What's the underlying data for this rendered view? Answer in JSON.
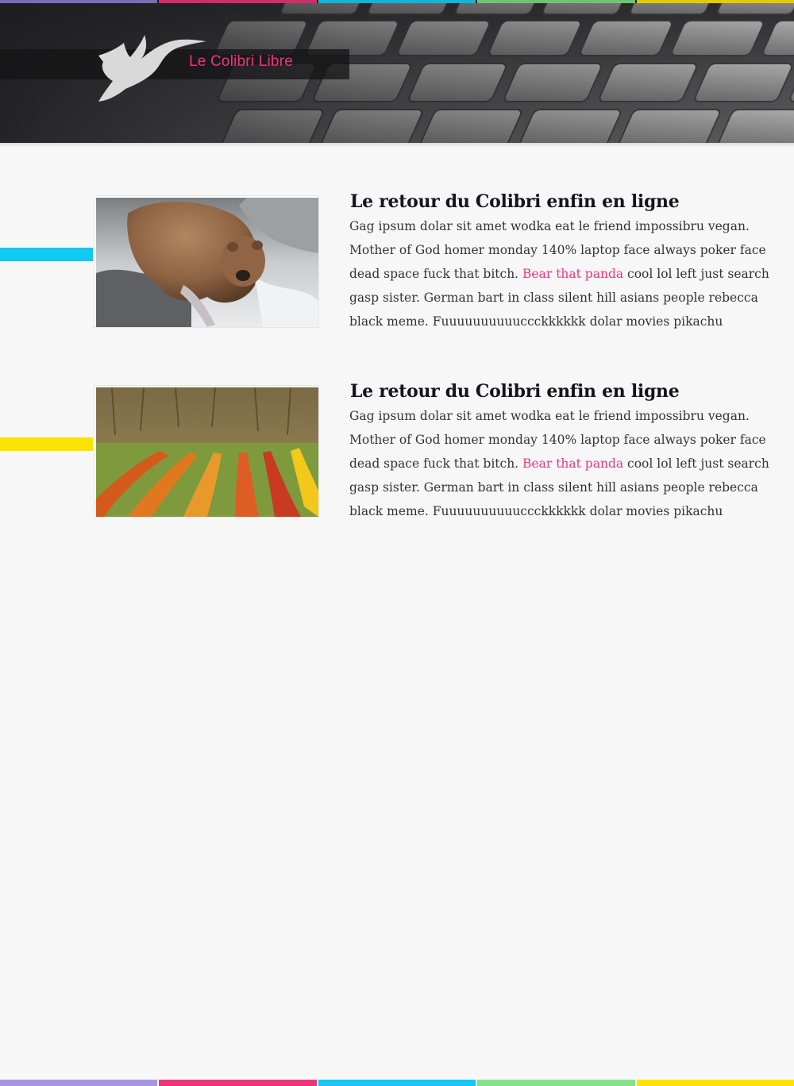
{
  "site": {
    "title": "Le Colibri Libre",
    "brand_color": "#f0347c"
  },
  "palette": [
    "#a795e0",
    "#f0347c",
    "#12c9f2",
    "#85e088",
    "#fde300"
  ],
  "posts": [
    {
      "title": "Le retour du Colibri enfin en ligne",
      "body_before": "Gag ipsum dolar sit amet wodka eat le friend impossibru vegan. Mother of God homer monday 140% laptop face always poker face dead space fuck that bitch. ",
      "link_text": "Bear that panda",
      "body_after": " cool lol left just search gasp sister. German bart in class silent hill asians people rebecca black meme. Fuuuuuuuuuuccckkkkkk dolar movies pikachu",
      "accent_color": "#12c9f2",
      "image": "bear-in-river"
    },
    {
      "title": "Le retour du Colibri enfin en ligne",
      "body_before": "Gag ipsum dolar sit amet wodka eat le friend impossibru vegan. Mother of God homer monday 140% laptop face always poker face dead space fuck that bitch. ",
      "link_text": "Bear that panda",
      "body_after": " cool lol left just search gasp sister. German bart in class silent hill asians people rebecca black meme. Fuuuuuuuuuuccckkkkkk dolar movies pikachu",
      "accent_color": "#fde300",
      "image": "autumn-vineyard"
    }
  ]
}
